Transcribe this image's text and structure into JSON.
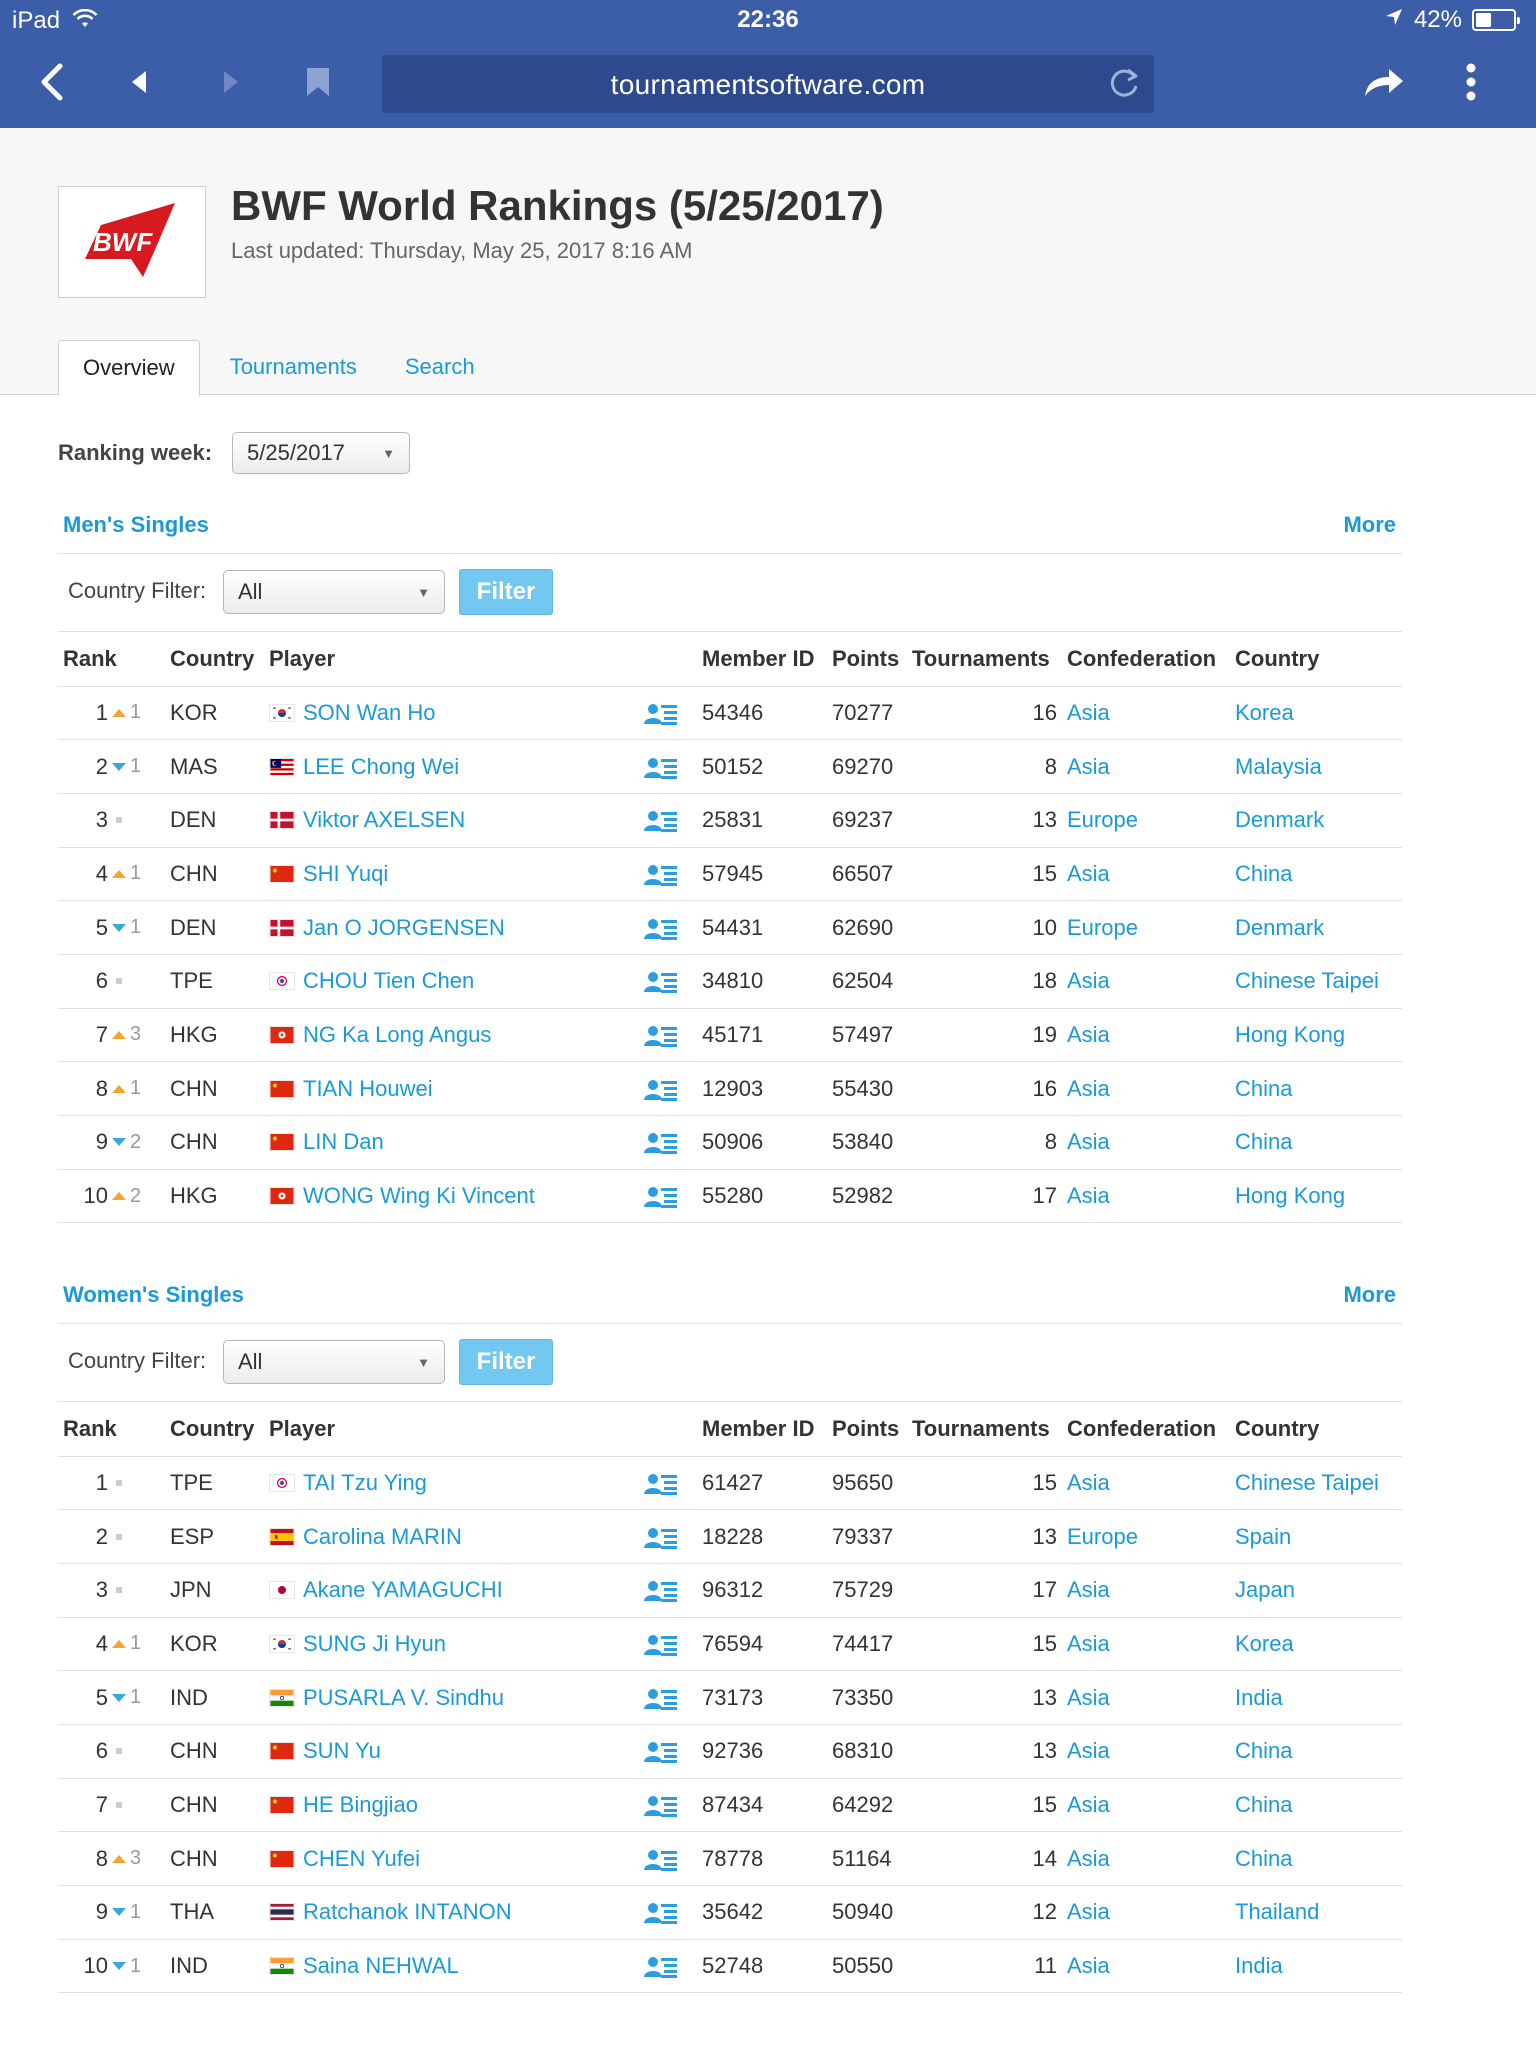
{
  "status_bar": {
    "device": "iPad",
    "time": "22:36",
    "battery": "42%",
    "battery_level": 0.42
  },
  "browser": {
    "url": "tournamentsoftware.com"
  },
  "header": {
    "logo_text": "BWF",
    "title": "BWF World Rankings (5/25/2017)",
    "subtitle": "Last updated: Thursday, May 25, 2017 8:16 AM"
  },
  "tabs": [
    {
      "label": "Overview",
      "active": true
    },
    {
      "label": "Tournaments",
      "active": false
    },
    {
      "label": "Search",
      "active": false
    }
  ],
  "ranking_week": {
    "label": "Ranking week:",
    "value": "5/25/2017"
  },
  "columns": [
    "Rank",
    "Country",
    "Player",
    "Member ID",
    "Points",
    "Tournaments",
    "Confederation",
    "Country"
  ],
  "sections": [
    {
      "title": "Men's Singles",
      "more": "More",
      "filter_label": "Country Filter:",
      "filter_value": "All",
      "filter_button": "Filter",
      "rows": [
        {
          "rank": "1",
          "trend": "up",
          "change": "1",
          "code": "KOR",
          "player": "SON Wan Ho",
          "member_id": "54346",
          "points": "70277",
          "tournaments": "16",
          "confederation": "Asia",
          "country": "Korea"
        },
        {
          "rank": "2",
          "trend": "down",
          "change": "1",
          "code": "MAS",
          "player": "LEE Chong Wei",
          "member_id": "50152",
          "points": "69270",
          "tournaments": "8",
          "confederation": "Asia",
          "country": "Malaysia"
        },
        {
          "rank": "3",
          "trend": "same",
          "change": "",
          "code": "DEN",
          "player": "Viktor AXELSEN",
          "member_id": "25831",
          "points": "69237",
          "tournaments": "13",
          "confederation": "Europe",
          "country": "Denmark"
        },
        {
          "rank": "4",
          "trend": "up",
          "change": "1",
          "code": "CHN",
          "player": "SHI Yuqi",
          "member_id": "57945",
          "points": "66507",
          "tournaments": "15",
          "confederation": "Asia",
          "country": "China"
        },
        {
          "rank": "5",
          "trend": "down",
          "change": "1",
          "code": "DEN",
          "player": "Jan O JORGENSEN",
          "member_id": "54431",
          "points": "62690",
          "tournaments": "10",
          "confederation": "Europe",
          "country": "Denmark"
        },
        {
          "rank": "6",
          "trend": "same",
          "change": "",
          "code": "TPE",
          "player": "CHOU Tien Chen",
          "member_id": "34810",
          "points": "62504",
          "tournaments": "18",
          "confederation": "Asia",
          "country": "Chinese Taipei"
        },
        {
          "rank": "7",
          "trend": "up",
          "change": "3",
          "code": "HKG",
          "player": "NG Ka Long Angus",
          "member_id": "45171",
          "points": "57497",
          "tournaments": "19",
          "confederation": "Asia",
          "country": "Hong Kong"
        },
        {
          "rank": "8",
          "trend": "up",
          "change": "1",
          "code": "CHN",
          "player": "TIAN Houwei",
          "member_id": "12903",
          "points": "55430",
          "tournaments": "16",
          "confederation": "Asia",
          "country": "China"
        },
        {
          "rank": "9",
          "trend": "down",
          "change": "2",
          "code": "CHN",
          "player": "LIN Dan",
          "member_id": "50906",
          "points": "53840",
          "tournaments": "8",
          "confederation": "Asia",
          "country": "China"
        },
        {
          "rank": "10",
          "trend": "up",
          "change": "2",
          "code": "HKG",
          "player": "WONG Wing Ki Vincent",
          "member_id": "55280",
          "points": "52982",
          "tournaments": "17",
          "confederation": "Asia",
          "country": "Hong Kong"
        }
      ]
    },
    {
      "title": "Women's Singles",
      "more": "More",
      "filter_label": "Country Filter:",
      "filter_value": "All",
      "filter_button": "Filter",
      "rows": [
        {
          "rank": "1",
          "trend": "same",
          "change": "",
          "code": "TPE",
          "player": "TAI Tzu Ying",
          "member_id": "61427",
          "points": "95650",
          "tournaments": "15",
          "confederation": "Asia",
          "country": "Chinese Taipei"
        },
        {
          "rank": "2",
          "trend": "same",
          "change": "",
          "code": "ESP",
          "player": "Carolina MARIN",
          "member_id": "18228",
          "points": "79337",
          "tournaments": "13",
          "confederation": "Europe",
          "country": "Spain"
        },
        {
          "rank": "3",
          "trend": "same",
          "change": "",
          "code": "JPN",
          "player": "Akane YAMAGUCHI",
          "member_id": "96312",
          "points": "75729",
          "tournaments": "17",
          "confederation": "Asia",
          "country": "Japan"
        },
        {
          "rank": "4",
          "trend": "up",
          "change": "1",
          "code": "KOR",
          "player": "SUNG Ji Hyun",
          "member_id": "76594",
          "points": "74417",
          "tournaments": "15",
          "confederation": "Asia",
          "country": "Korea"
        },
        {
          "rank": "5",
          "trend": "down",
          "change": "1",
          "code": "IND",
          "player": "PUSARLA V. Sindhu",
          "member_id": "73173",
          "points": "73350",
          "tournaments": "13",
          "confederation": "Asia",
          "country": "India"
        },
        {
          "rank": "6",
          "trend": "same",
          "change": "",
          "code": "CHN",
          "player": "SUN Yu",
          "member_id": "92736",
          "points": "68310",
          "tournaments": "13",
          "confederation": "Asia",
          "country": "China"
        },
        {
          "rank": "7",
          "trend": "same",
          "change": "",
          "code": "CHN",
          "player": "HE Bingjiao",
          "member_id": "87434",
          "points": "64292",
          "tournaments": "15",
          "confederation": "Asia",
          "country": "China"
        },
        {
          "rank": "8",
          "trend": "up",
          "change": "3",
          "code": "CHN",
          "player": "CHEN Yufei",
          "member_id": "78778",
          "points": "51164",
          "tournaments": "14",
          "confederation": "Asia",
          "country": "China"
        },
        {
          "rank": "9",
          "trend": "down",
          "change": "1",
          "code": "THA",
          "player": "Ratchanok INTANON",
          "member_id": "35642",
          "points": "50940",
          "tournaments": "12",
          "confederation": "Asia",
          "country": "Thailand"
        },
        {
          "rank": "10",
          "trend": "down",
          "change": "1",
          "code": "IND",
          "player": "Saina NEHWAL",
          "member_id": "52748",
          "points": "50550",
          "tournaments": "11",
          "confederation": "Asia",
          "country": "India"
        }
      ]
    }
  ],
  "colors": {
    "chrome": "#3c5ea9",
    "link": "#1a9ad6",
    "trend_up": "#f2a534",
    "trend_down": "#38a7dc",
    "filter_button": "#72c8f0",
    "logo_red": "#d71920"
  }
}
